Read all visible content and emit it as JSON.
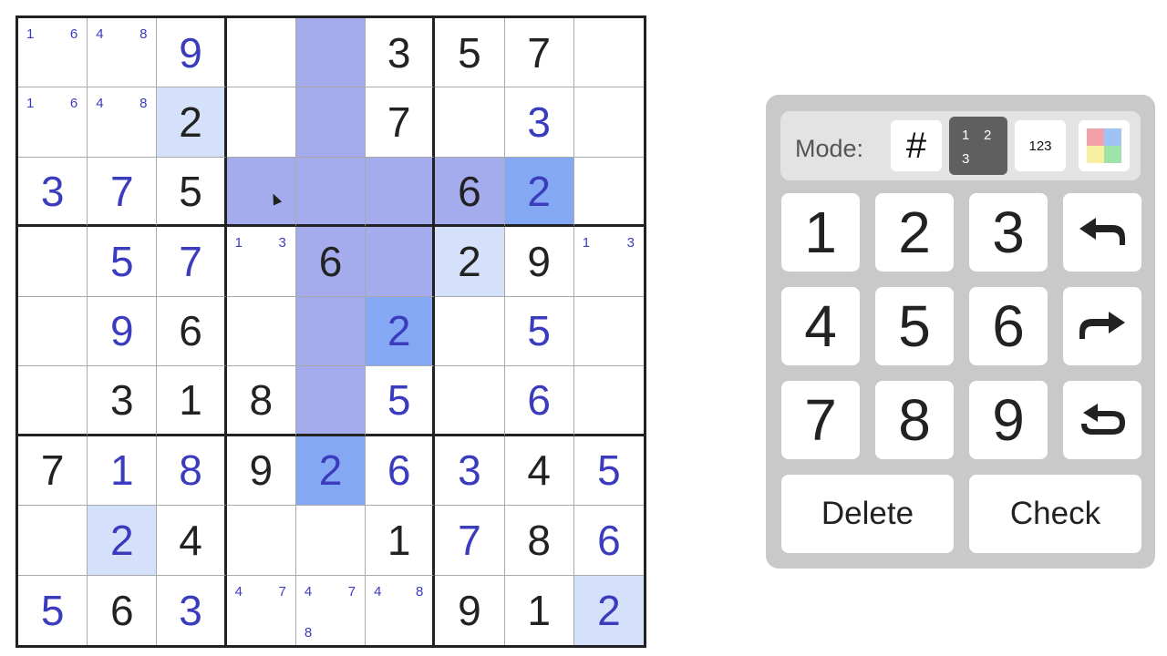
{
  "board": {
    "cells": [
      [
        {
          "c": [
            1,
            6
          ]
        },
        {
          "c": [
            4,
            8
          ]
        },
        {
          "v": "9",
          "t": "e"
        },
        {},
        {
          "hl": "mid"
        },
        {
          "v": "3",
          "t": "g"
        },
        {
          "v": "5",
          "t": "g"
        },
        {
          "v": "7",
          "t": "g"
        },
        {}
      ],
      [
        {
          "c": [
            1,
            6
          ]
        },
        {
          "c": [
            4,
            8
          ]
        },
        {
          "v": "2",
          "t": "g",
          "hl": "light"
        },
        {},
        {
          "hl": "mid"
        },
        {
          "v": "7",
          "t": "g"
        },
        {},
        {
          "v": "3",
          "t": "e"
        },
        {}
      ],
      [
        {
          "v": "3",
          "t": "e"
        },
        {
          "v": "7",
          "t": "e"
        },
        {
          "v": "5",
          "t": "g"
        },
        {
          "hl": "mid"
        },
        {
          "hl": "mid"
        },
        {
          "hl": "mid"
        },
        {
          "v": "6",
          "t": "g",
          "hl": "mid"
        },
        {
          "v": "2",
          "t": "e",
          "hl": "strong"
        },
        {}
      ],
      [
        {},
        {
          "v": "5",
          "t": "e"
        },
        {
          "v": "7",
          "t": "e"
        },
        {
          "c": [
            1,
            3
          ]
        },
        {
          "v": "6",
          "t": "g",
          "hl": "mid"
        },
        {
          "hl": "mid"
        },
        {
          "v": "2",
          "t": "g",
          "hl": "light"
        },
        {
          "v": "9",
          "t": "g"
        },
        {
          "c": [
            1,
            3
          ]
        }
      ],
      [
        {},
        {
          "v": "9",
          "t": "e"
        },
        {
          "v": "6",
          "t": "g"
        },
        {},
        {
          "hl": "mid"
        },
        {
          "v": "2",
          "t": "e",
          "hl": "strong"
        },
        {},
        {
          "v": "5",
          "t": "e"
        },
        {}
      ],
      [
        {},
        {
          "v": "3",
          "t": "g"
        },
        {
          "v": "1",
          "t": "g"
        },
        {
          "v": "8",
          "t": "g"
        },
        {
          "hl": "mid"
        },
        {
          "v": "5",
          "t": "e"
        },
        {},
        {
          "v": "6",
          "t": "e"
        },
        {}
      ],
      [
        {
          "v": "7",
          "t": "g"
        },
        {
          "v": "1",
          "t": "e"
        },
        {
          "v": "8",
          "t": "e"
        },
        {
          "v": "9",
          "t": "g"
        },
        {
          "v": "2",
          "t": "e",
          "hl": "strong"
        },
        {
          "v": "6",
          "t": "e"
        },
        {
          "v": "3",
          "t": "e"
        },
        {
          "v": "4",
          "t": "g"
        },
        {
          "v": "5",
          "t": "e"
        }
      ],
      [
        {},
        {
          "v": "2",
          "t": "e",
          "hl": "light"
        },
        {
          "v": "4",
          "t": "g"
        },
        {},
        {},
        {
          "v": "1",
          "t": "g"
        },
        {
          "v": "7",
          "t": "e"
        },
        {
          "v": "8",
          "t": "g"
        },
        {
          "v": "6",
          "t": "e"
        }
      ],
      [
        {
          "v": "5",
          "t": "e"
        },
        {
          "v": "6",
          "t": "g"
        },
        {
          "v": "3",
          "t": "e"
        },
        {
          "c": [
            4,
            7
          ]
        },
        {
          "c": [
            4,
            7,
            8
          ]
        },
        {
          "c": [
            4,
            8
          ]
        },
        {
          "v": "9",
          "t": "g"
        },
        {
          "v": "1",
          "t": "g"
        },
        {
          "v": "2",
          "t": "e",
          "hl": "light"
        }
      ]
    ]
  },
  "colors": {
    "given_digit": "#222222",
    "entered_digit": "#3b3bbd",
    "highlight_mid": "#a5acee",
    "highlight_strong": "#85a8f4",
    "highlight_light": "#d5e0fa",
    "panel_bg": "#c9c9c9"
  },
  "panel": {
    "mode_label": "Mode:",
    "mode_normal": "#",
    "mode_candidates": [
      "1",
      "2",
      "3"
    ],
    "mode_123": "123",
    "mode_color_swatches": [
      "#f4a0a8",
      "#9fc3f4",
      "#f6eea0",
      "#9fe3a8"
    ],
    "active_mode": "candidates",
    "keys": [
      "1",
      "2",
      "3",
      "4",
      "5",
      "6",
      "7",
      "8",
      "9"
    ],
    "undo_icon": "undo-arrow-icon",
    "redo_icon": "redo-arrow-icon",
    "restart_icon": "restart-icon",
    "delete_label": "Delete",
    "check_label": "Check"
  }
}
